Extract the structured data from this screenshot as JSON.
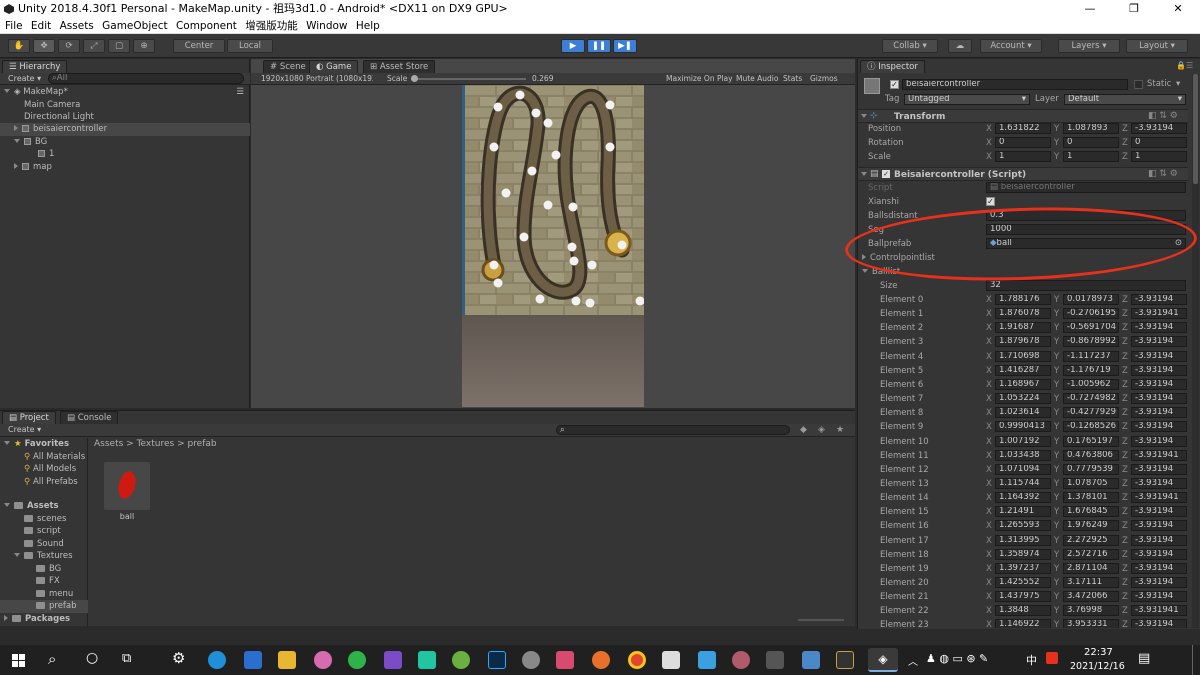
{
  "window": {
    "title": "Unity 2018.4.30f1 Personal - MakeMap.unity - 祖玛3d1.0 - Android* <DX11 on DX9 GPU>",
    "minimize": "—",
    "maximize": "❐",
    "close": "✕"
  },
  "menu": [
    "File",
    "Edit",
    "Assets",
    "GameObject",
    "Component",
    "增强版功能",
    "Window",
    "Help"
  ],
  "toolbar": {
    "center": "Center",
    "local": "Local",
    "collab": "Collab",
    "account": "Account",
    "layers": "Layers",
    "layout": "Layout"
  },
  "hierarchy": {
    "tab": "Hierarchy",
    "create": "Create",
    "search_placeholder": "All",
    "scene": "MakeMap*",
    "items": [
      "Main Camera",
      "Directional Light",
      "beisaiercontroller",
      "BG",
      "1",
      "map"
    ]
  },
  "scene_tabs": {
    "scene": "Scene",
    "game": "Game",
    "asset_store": "Asset Store"
  },
  "game_bar": {
    "resolution": "1920x1080 Portrait (1080x1920)",
    "scale_label": "Scale",
    "scale_value": "0.269",
    "maximize": "Maximize On Play",
    "mute": "Mute Audio",
    "stats": "Stats",
    "gizmos": "Gizmos"
  },
  "project": {
    "tab": "Project",
    "console_tab": "Console",
    "create": "Create",
    "favorites": "Favorites",
    "fav_items": [
      "All Materials",
      "All Models",
      "All Prefabs"
    ],
    "assets": "Assets",
    "asset_items": [
      "scenes",
      "script",
      "Sound",
      "Textures",
      "BG",
      "FX",
      "menu",
      "prefab"
    ],
    "packages": "Packages",
    "breadcrumb": [
      "Assets",
      "Textures",
      "prefab"
    ],
    "file_name": "ball"
  },
  "inspector": {
    "tab": "Inspector",
    "object_name": "beisaiercontroller",
    "static": "Static",
    "tag_label": "Tag",
    "tag_value": "Untagged",
    "layer_label": "Layer",
    "layer_value": "Default",
    "transform": "Transform",
    "position_label": "Position",
    "pos": [
      "1.631822",
      "1.087893",
      "-3.93194"
    ],
    "rotation_label": "Rotation",
    "rot": [
      "0",
      "0",
      "0"
    ],
    "scale_label": "Scale",
    "scl": [
      "1",
      "1",
      "1"
    ],
    "script_component": "Beisaiercontroller (Script)",
    "script_label": "Script",
    "script_value": "beisaiercontroller",
    "xianshi_label": "Xianshi",
    "ballsdistant_label": "Ballsdistant",
    "ballsdistant_value": "0.3",
    "seg_label": "Seg",
    "seg_value": "1000",
    "ballprefab_label": "Ballprefab",
    "ballprefab_value": "ball",
    "controlpointlist_label": "Controlpointlist",
    "balllist_label": "Balllist",
    "size_label": "Size",
    "size_value": "32",
    "elements": [
      [
        "Element 0",
        "1.788176",
        "0.0178973",
        "-3.93194"
      ],
      [
        "Element 1",
        "1.876078",
        "-0.2706195",
        "-3.931941"
      ],
      [
        "Element 2",
        "1.91687",
        "-0.5691704",
        "-3.93194"
      ],
      [
        "Element 3",
        "1.879678",
        "-0.8678992",
        "-3.93194"
      ],
      [
        "Element 4",
        "1.710698",
        "-1.117237",
        "-3.93194"
      ],
      [
        "Element 5",
        "1.416287",
        "-1.176719",
        "-3.93194"
      ],
      [
        "Element 6",
        "1.168967",
        "-1.005962",
        "-3.93194"
      ],
      [
        "Element 7",
        "1.053224",
        "-0.7274982",
        "-3.93194"
      ],
      [
        "Element 8",
        "1.023614",
        "-0.4277929",
        "-3.93194"
      ],
      [
        "Element 9",
        "0.9990413",
        "-0.1268526",
        "-3.93194"
      ],
      [
        "Element 10",
        "1.007192",
        "0.1765197",
        "-3.93194"
      ],
      [
        "Element 11",
        "1.033438",
        "0.4763806",
        "-3.931941"
      ],
      [
        "Element 12",
        "1.071094",
        "0.7779539",
        "-3.93194"
      ],
      [
        "Element 13",
        "1.115744",
        "1.078705",
        "-3.93194"
      ],
      [
        "Element 14",
        "1.164392",
        "1.378101",
        "-3.931941"
      ],
      [
        "Element 15",
        "1.21491",
        "1.676845",
        "-3.93194"
      ],
      [
        "Element 16",
        "1.265593",
        "1.976249",
        "-3.93194"
      ],
      [
        "Element 17",
        "1.313995",
        "2.272925",
        "-3.93194"
      ],
      [
        "Element 18",
        "1.358974",
        "2.572716",
        "-3.93194"
      ],
      [
        "Element 19",
        "1.397237",
        "2.871104",
        "-3.93194"
      ],
      [
        "Element 20",
        "1.425552",
        "3.17111",
        "-3.93194"
      ],
      [
        "Element 21",
        "1.437975",
        "3.472066",
        "-3.93194"
      ],
      [
        "Element 22",
        "1.3848",
        "3.76998",
        "-3.931941"
      ],
      [
        "Element 23",
        "1.146922",
        "3.953331",
        "-3.93194"
      ]
    ]
  },
  "taskbar": {
    "time": "22:37",
    "date": "2021/12/16",
    "ime": "中"
  },
  "colors": {
    "accent_play": "#3d7fd6",
    "annotation": "#e8311c",
    "selection": "#3e3e3e"
  }
}
